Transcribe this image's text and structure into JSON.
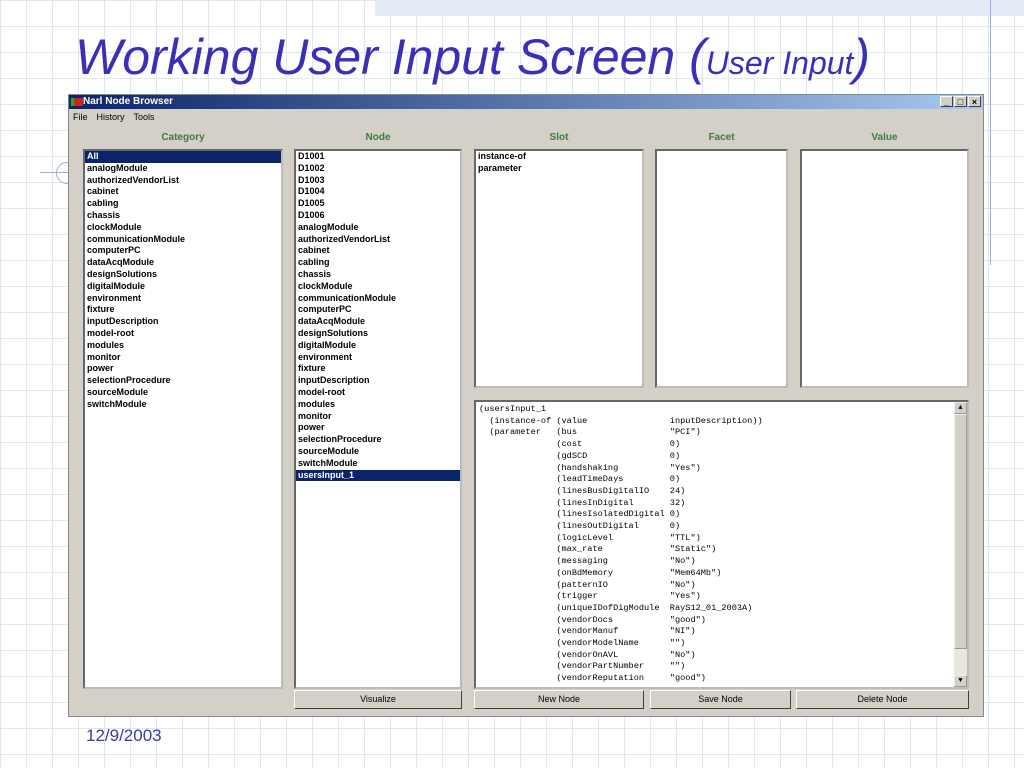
{
  "slide": {
    "title_main": "Working User Input Screen (",
    "title_sub": "User Input",
    "title_close": ")",
    "date": "12/9/2003"
  },
  "window": {
    "title": "Narl Node Browser",
    "controls": [
      "_",
      "□",
      "×"
    ]
  },
  "menu": [
    "File",
    "History",
    "Tools"
  ],
  "columns": {
    "category": "Category",
    "node": "Node",
    "slot": "Slot",
    "facet": "Facet",
    "value": "Value"
  },
  "category_items": [
    "All",
    "analogModule",
    "authorizedVendorList",
    "cabinet",
    "cabling",
    "chassis",
    "clockModule",
    "communicationModule",
    "computerPC",
    "dataAcqModule",
    "designSolutions",
    "digitalModule",
    "environment",
    "fixture",
    "inputDescription",
    "model-root",
    "modules",
    "monitor",
    "power",
    "selectionProcedure",
    "sourceModule",
    "switchModule"
  ],
  "category_selected": 0,
  "node_items": [
    "D1001",
    "D1002",
    "D1003",
    "D1004",
    "D1005",
    "D1006",
    "analogModule",
    "authorizedVendorList",
    "cabinet",
    "cabling",
    "chassis",
    "clockModule",
    "communicationModule",
    "computerPC",
    "dataAcqModule",
    "designSolutions",
    "digitalModule",
    "environment",
    "fixture",
    "inputDescription",
    "model-root",
    "modules",
    "monitor",
    "power",
    "selectionProcedure",
    "sourceModule",
    "switchModule",
    "usersInput_1"
  ],
  "node_selected": 27,
  "slot_items": [
    "instance-of",
    "parameter"
  ],
  "code_lines": [
    "(usersInput_1",
    "  (instance-of (value                inputDescription))",
    "  (parameter   (bus                  \"PCI\")",
    "               (cost                 0)",
    "               (gdSCD                0)",
    "               (handshaking          \"Yes\")",
    "               (leadTimeDays         0)",
    "               (linesBusDigitalIO    24)",
    "               (linesInDigital       32)",
    "               (linesIsolatedDigital 0)",
    "               (linesOutDigital      0)",
    "               (logicLevel           \"TTL\")",
    "               (max_rate             \"Static\")",
    "               (messaging            \"No\")",
    "               (onBdMemory           \"Mem64Mb\")",
    "               (patternIO            \"No\")",
    "               (trigger              \"Yes\")",
    "               (uniqueIDofDigModule  RayS12_01_2003A)",
    "               (vendorDocs           \"good\")",
    "               (vendorManuf          \"NI\")",
    "               (vendorModelName      \"\")",
    "               (vendorOnAVL          \"No\")",
    "               (vendorPartNumber     \"\")",
    "               (vendorReputation     \"good\")"
  ],
  "buttons": {
    "visualize": "Visualize",
    "new_node": "New Node",
    "save_node": "Save Node",
    "delete_node": "Delete Node"
  },
  "scroll": {
    "up": "▲",
    "down": "▼"
  }
}
